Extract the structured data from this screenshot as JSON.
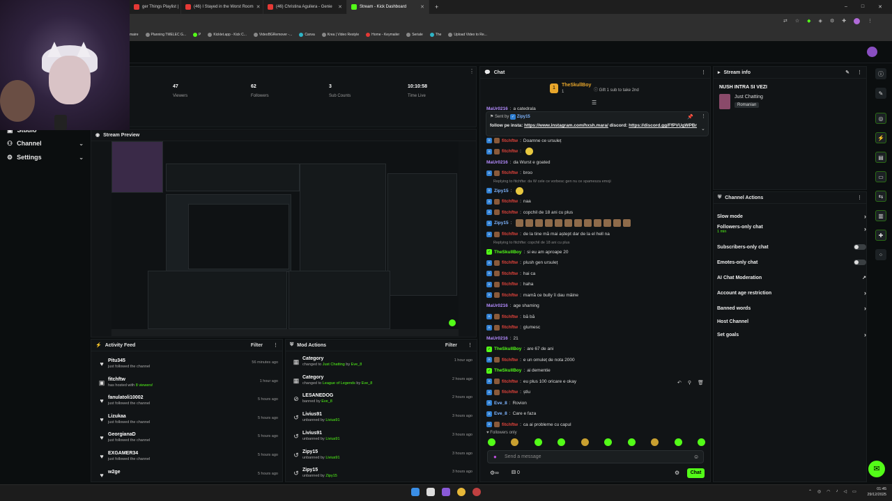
{
  "browser": {
    "tabs": [
      {
        "title": "ger Things Playlist |",
        "active": false
      },
      {
        "title": "(46) I Stayed in the Worst Room",
        "active": false
      },
      {
        "title": "(46) Christina Aguilera - Genie",
        "active": false
      },
      {
        "title": "Stream - Kick Dashboard",
        "active": true
      }
    ],
    "new_tab": "+",
    "window_controls": [
      "–",
      "□",
      "✕"
    ],
    "bookmarks": [
      "maire",
      "Planning TMELEC G...",
      "P",
      "Kicklet.app - Kick C...",
      "VideoBGRemover -...",
      "Canva",
      "Krea | Video Restyle",
      "Home - Keymailer",
      "Seriale",
      "The",
      "Upload Video to Re..."
    ]
  },
  "sidebar": {
    "items": [
      {
        "label": "Studio",
        "icon": "studio-icon"
      },
      {
        "label": "Channel",
        "icon": "channel-icon"
      },
      {
        "label": "Settings",
        "icon": "gear-icon"
      }
    ]
  },
  "stats": [
    {
      "value": "47",
      "label": "Viewers"
    },
    {
      "value": "62",
      "label": "Followers"
    },
    {
      "value": "3",
      "label": "Sub Counts"
    },
    {
      "value": "10:10:58",
      "label": "Time Live"
    }
  ],
  "stream_preview": {
    "title": "Stream Preview"
  },
  "activity_feed": {
    "title": "Activity Feed",
    "filter": "Filter",
    "rows": [
      {
        "icon": "heart-icon",
        "name": "Pitu345",
        "action": "just followed the channel",
        "time": "56 minutes ago",
        "extra": ""
      },
      {
        "icon": "host-icon",
        "name": "fitchftw",
        "action": "has hosted with",
        "time": "1 hour ago",
        "extra": "8 viewers!"
      },
      {
        "icon": "heart-icon",
        "name": "fanulatoli10002",
        "action": "just followed the channel",
        "time": "5 hours ago",
        "extra": ""
      },
      {
        "icon": "heart-icon",
        "name": "Lizukaa",
        "action": "just followed the channel",
        "time": "5 hours ago",
        "extra": ""
      },
      {
        "icon": "heart-icon",
        "name": "GeorgianaD",
        "action": "just followed the channel",
        "time": "5 hours ago",
        "extra": ""
      },
      {
        "icon": "heart-icon",
        "name": "EXGAMER34",
        "action": "just followed the channel",
        "time": "5 hours ago",
        "extra": ""
      },
      {
        "icon": "heart-icon",
        "name": "w2ge",
        "action": "",
        "time": "5 hours ago",
        "extra": ""
      }
    ]
  },
  "mod_actions": {
    "title": "Mod Actions",
    "filter": "Filter",
    "rows": [
      {
        "icon": "category-icon",
        "name": "Category",
        "action": "changed to",
        "target": "Just Chatting",
        "by": "by",
        "mod": "Eve_8",
        "time": "1 hour ago"
      },
      {
        "icon": "category-icon",
        "name": "Category",
        "action": "changed to",
        "target": "League of Legends",
        "by": "by",
        "mod": "Eve_8",
        "time": "2 hours ago"
      },
      {
        "icon": "ban-icon",
        "name": "LESANEDOG",
        "action": "banned by",
        "target": "",
        "by": "",
        "mod": "Eve_8",
        "time": "2 hours ago"
      },
      {
        "icon": "undo-icon",
        "name": "Livius91",
        "action": "unbanned by",
        "target": "",
        "by": "",
        "mod": "Livius91",
        "time": "3 hours ago"
      },
      {
        "icon": "undo-icon",
        "name": "Livius91",
        "action": "unbanned by",
        "target": "",
        "by": "",
        "mod": "Livius91",
        "time": "3 hours ago"
      },
      {
        "icon": "undo-icon",
        "name": "Zipy15",
        "action": "unbanned by",
        "target": "",
        "by": "",
        "mod": "Livius91",
        "time": "3 hours ago"
      },
      {
        "icon": "undo-icon",
        "name": "Zipy15",
        "action": "unbanned by",
        "target": "",
        "by": "",
        "mod": "Zipy15",
        "time": "3 hours ago"
      }
    ]
  },
  "chat": {
    "title": "Chat",
    "top_gifter": {
      "name": "TheSkullBoy",
      "count": "1",
      "goal": "Gift 1 sub to take 2nd"
    },
    "pinned": {
      "sent_by_label": "Sent by",
      "sender": "Zipy15",
      "text_prefix": "follow pe insta:",
      "link1": "https://www.instagram.com/hxsh.mara/",
      "mid": "discord:",
      "link2": "https://discord.gg/FfPVUgWPBr"
    },
    "messages": [
      {
        "user": "MaUr0216",
        "text": "a catedrala",
        "reply": ""
      },
      {
        "user": "fitchftw",
        "text": "Doamne ce ursuleț",
        "reply": ""
      },
      {
        "user": "fitchftw",
        "text": "",
        "reply": "",
        "emote": true
      },
      {
        "user": "MaUr0216",
        "text": "da Wurst e goated",
        "reply": ""
      },
      {
        "user": "fitchftw",
        "text": "broo",
        "reply": ""
      },
      {
        "user": "",
        "text": "",
        "reply": "Replying to fitchftw: da W cele ce vorbesc gen nu ce spamesza emoji"
      },
      {
        "user": "Zipy15",
        "text": "",
        "reply": "",
        "emote": true
      },
      {
        "user": "fitchftw",
        "text": "naa",
        "reply": ""
      },
      {
        "user": "fitchftw",
        "text": "copchil de 18 ani cu plus",
        "reply": ""
      },
      {
        "user": "Zipy15",
        "text": "",
        "reply": "",
        "emotes": 12
      },
      {
        "user": "fitchftw",
        "text": "de la tine mă mai aștept dar de la el hell na",
        "reply": ""
      },
      {
        "user": "",
        "text": "",
        "reply": "Replying to fitchftw: copchil de 18 ani cu plus"
      },
      {
        "user": "TheSkullBoy",
        "text": "si eu am aproape 20",
        "reply": ""
      },
      {
        "user": "fitchftw",
        "text": "plush gen ursuleț",
        "reply": ""
      },
      {
        "user": "fitchftw",
        "text": "hai ca",
        "reply": ""
      },
      {
        "user": "fitchftw",
        "text": "haha",
        "reply": ""
      },
      {
        "user": "fitchftw",
        "text": "mamă ce bully îi dau mâine",
        "reply": ""
      },
      {
        "user": "MaUr0216",
        "text": "age shaming",
        "reply": ""
      },
      {
        "user": "fitchftw",
        "text": "bă bă",
        "reply": ""
      },
      {
        "user": "fitchftw",
        "text": "glumesc",
        "reply": ""
      },
      {
        "user": "MaUr0216",
        "text": "21",
        "reply": ""
      },
      {
        "user": "TheSkullBoy",
        "text": "are 67 de ani",
        "reply": ""
      },
      {
        "user": "fitchftw",
        "text": "e un omuleț de nota 2000",
        "reply": ""
      },
      {
        "user": "TheSkullBoy",
        "text": "ai dementie",
        "reply": ""
      },
      {
        "user": "fitchftw",
        "text": "eu plus 100 oricare e okay",
        "reply": ""
      },
      {
        "user": "fitchftw",
        "text": "ștlu",
        "reply": ""
      },
      {
        "user": "Eve_8",
        "text": "Rovion",
        "reply": ""
      },
      {
        "user": "Eve_8",
        "text": "Care e faza",
        "reply": ""
      },
      {
        "user": "fitchftw",
        "text": "ca ai probleme cu capul",
        "reply": ""
      }
    ],
    "followers_only": "Followers only",
    "input_placeholder": "Send a message",
    "bottom": {
      "count": "0",
      "send_label": "Chat"
    }
  },
  "stream_info": {
    "title": "Stream info",
    "stream_title": "NUSH INTRA SI VEZI",
    "category": "Just Chatting",
    "language": "Romanian"
  },
  "channel_actions": {
    "title": "Channel Actions",
    "items": [
      {
        "label": "Slow mode",
        "sub": "",
        "control": "arrow"
      },
      {
        "label": "Followers-only chat",
        "sub": "1 min",
        "control": "arrow"
      },
      {
        "label": "Subscribers-only chat",
        "sub": "",
        "control": "toggle"
      },
      {
        "label": "Emotes-only chat",
        "sub": "",
        "control": "toggle"
      },
      {
        "label": "AI Chat Moderation",
        "sub": "",
        "control": "external"
      },
      {
        "label": "Account age restriction",
        "sub": "",
        "control": "arrow"
      },
      {
        "label": "Banned words",
        "sub": "",
        "control": "arrow"
      },
      {
        "label": "Host Channel",
        "sub": "",
        "control": "none"
      },
      {
        "label": "Set goals",
        "sub": "",
        "control": "arrow"
      }
    ]
  },
  "taskbar": {
    "time": "01:45",
    "date": "29/12/2025"
  },
  "colors": {
    "accent": "#53fc18",
    "bg": "#0b0e0f",
    "panel": "#111416",
    "username_red": "#e0433b",
    "username_purple": "#b58cff",
    "username_green": "#53fc18",
    "username_blue": "#7fb5ff"
  }
}
